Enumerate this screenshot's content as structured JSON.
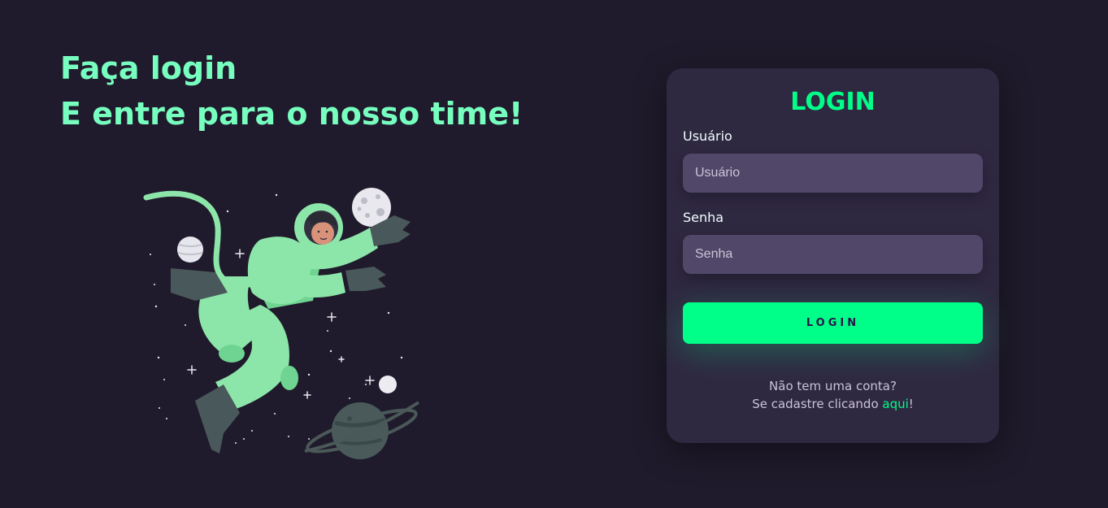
{
  "hero": {
    "line1": "Faça login",
    "line2": "E entre para o nosso time!"
  },
  "illustration": {
    "icon": "astronaut-in-space-illustration",
    "accent_color": "#8de6a9"
  },
  "login_card": {
    "title": "LOGIN",
    "username_label": "Usuário",
    "username_placeholder": "Usuário",
    "username_value": "",
    "password_label": "Senha",
    "password_placeholder": "Senha",
    "password_value": "",
    "button_label": "LOGIN",
    "signup_question": "Não tem uma conta?",
    "signup_prefix": "Se cadastre clicando ",
    "signup_link": "aqui",
    "signup_suffix": "!"
  },
  "colors": {
    "background": "#201b2c",
    "card": "#2f2841",
    "input": "#514869",
    "accent": "#00ff88",
    "headline": "#77ffc0"
  }
}
